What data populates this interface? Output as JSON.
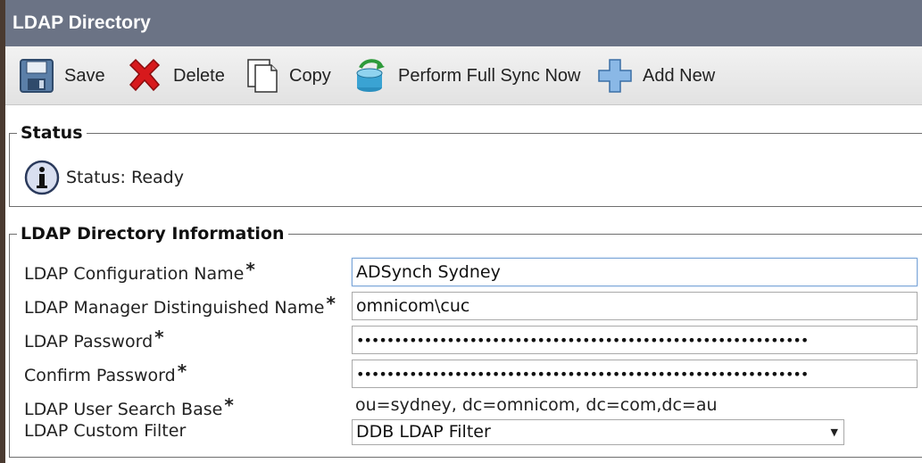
{
  "window": {
    "title": "LDAP Directory"
  },
  "toolbar": {
    "save_label": "Save",
    "delete_label": "Delete",
    "copy_label": "Copy",
    "sync_label": "Perform Full Sync Now",
    "add_label": "Add New"
  },
  "status": {
    "legend": "Status",
    "text": "Status: Ready"
  },
  "info": {
    "legend": "LDAP Directory Information",
    "required_mark": "*",
    "config_name": {
      "label": "LDAP Configuration Name",
      "value": "ADSynch Sydney"
    },
    "manager_dn": {
      "label": "LDAP Manager Distinguished Name",
      "value": "omnicom\\cuc"
    },
    "password": {
      "label": "LDAP Password",
      "value": "••••••••••••••••••••••••••••••••••••••••••••••••••••••••••••"
    },
    "confirm_password": {
      "label": "Confirm Password",
      "value": "••••••••••••••••••••••••••••••••••••••••••••••••••••••••••••"
    },
    "search_base": {
      "label": "LDAP User Search Base",
      "value": "ou=sydney, dc=omnicom, dc=com,dc=au"
    },
    "custom_filter": {
      "label": "LDAP Custom Filter",
      "selected": "DDB LDAP Filter"
    }
  }
}
